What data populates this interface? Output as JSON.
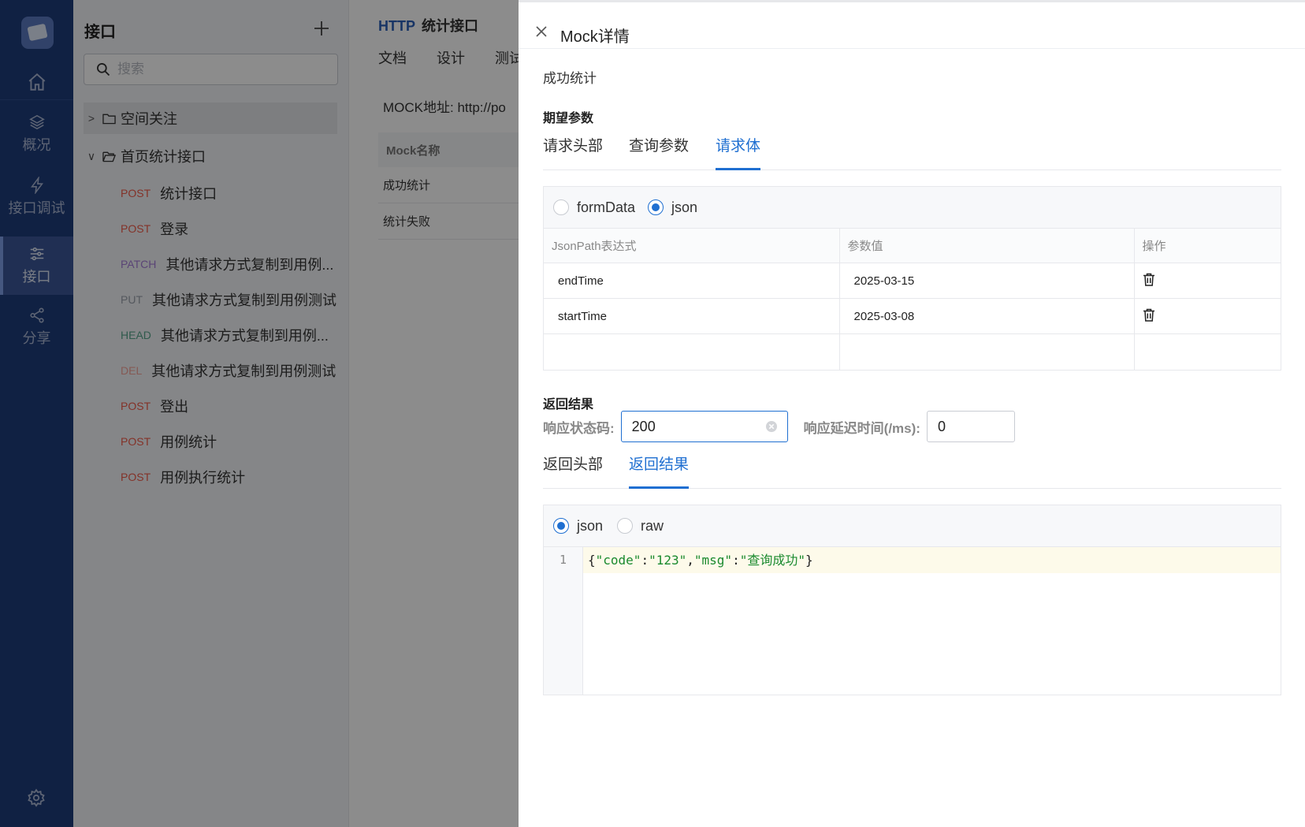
{
  "nav": {
    "items": [
      {
        "label": "概况",
        "icon": "layers-icon"
      },
      {
        "label": "接口调试",
        "icon": "lightning-icon"
      },
      {
        "label": "接口",
        "icon": "sliders-icon"
      },
      {
        "label": "分享",
        "icon": "share-icon"
      }
    ]
  },
  "sidebar": {
    "title": "接口",
    "search_placeholder": "搜索",
    "folders": [
      {
        "label": "空间关注",
        "arrow": ">"
      },
      {
        "label": "首页统计接口",
        "arrow": "v"
      }
    ],
    "apis": [
      {
        "method": "POST",
        "name": "统计接口"
      },
      {
        "method": "POST",
        "name": "登录"
      },
      {
        "method": "PATCH",
        "name": "其他请求方式复制到用例..."
      },
      {
        "method": "PUT",
        "name": "其他请求方式复制到用例测试"
      },
      {
        "method": "HEAD",
        "name": "其他请求方式复制到用例..."
      },
      {
        "method": "DEL",
        "name": "其他请求方式复制到用例测试"
      },
      {
        "method": "POST",
        "name": "登出"
      },
      {
        "method": "POST",
        "name": "用例统计"
      },
      {
        "method": "POST",
        "name": "用例执行统计"
      }
    ]
  },
  "main": {
    "protocol": "HTTP",
    "api_name": "统计接口",
    "tabs": [
      "文档",
      "设计",
      "测试"
    ],
    "mock_address": "MOCK地址: http://po",
    "table_header": "Mock名称",
    "rows": [
      "成功统计",
      "统计失败"
    ]
  },
  "drawer": {
    "title": "Mock详情",
    "mock_name": "成功统计",
    "expect_section": "期望参数",
    "expect_tabs": [
      "请求头部",
      "查询参数",
      "请求体"
    ],
    "body_types": [
      "formData",
      "json"
    ],
    "param_headers": [
      "JsonPath表达式",
      "参数值",
      "操作"
    ],
    "params": [
      {
        "path": "endTime",
        "value": "2025-03-15"
      },
      {
        "path": "startTime",
        "value": "2025-03-08"
      }
    ],
    "result_section": "返回结果",
    "status_label": "响应状态码:",
    "status_value": "200",
    "delay_label": "响应延迟时间(/ms):",
    "delay_value": "0",
    "result_tabs": [
      "返回头部",
      "返回结果"
    ],
    "result_types": [
      "json",
      "raw"
    ],
    "code_line_number": "1",
    "code": {
      "p1": "{",
      "k1": "\"code\"",
      "c1": ":",
      "v1": "\"123\"",
      "c2": ",",
      "k2": "\"msg\"",
      "c3": ":",
      "v2": "\"查询成功\"",
      "p2": "}"
    }
  },
  "colors": {
    "nav_bg": "#1e3d7b",
    "accent": "#1f6fd1",
    "post": "#ef5b4a",
    "patch": "#a57cd8",
    "put": "#9aa1ab",
    "head": "#56a48a",
    "del": "#f2a39a"
  }
}
